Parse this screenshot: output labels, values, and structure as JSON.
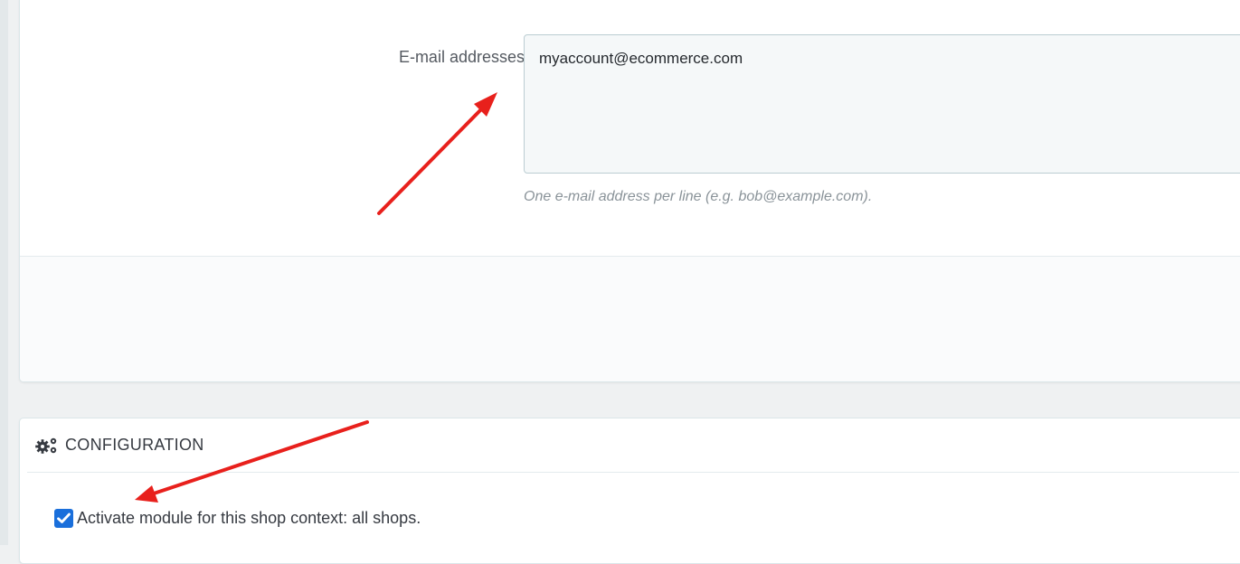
{
  "email_form": {
    "label": "E-mail addresses",
    "value": "myaccount@ecommerce.com",
    "help": "One e-mail address per line (e.g. bob@example.com)."
  },
  "configuration": {
    "title": "CONFIGURATION",
    "icon": "gears-icon",
    "activate_label": "Activate module for this shop context: all shops.",
    "activate_checked": true
  },
  "colors": {
    "annotation_arrow": "#e8201c",
    "checkbox": "#1a6fdb",
    "page_background": "#eff1f2"
  }
}
